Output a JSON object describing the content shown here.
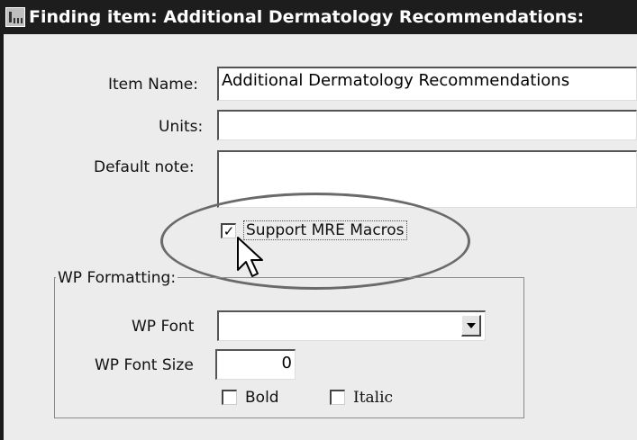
{
  "window": {
    "title": "Finding item: Additional Dermatology Recommendations:"
  },
  "form": {
    "item_name_label": "Item Name:",
    "item_name_value": "Additional Dermatology Recommendations",
    "units_label": "Units:",
    "units_value": "",
    "default_note_label": "Default note:",
    "default_note_value": "",
    "support_mre_label": "Support MRE Macros",
    "support_mre_checked": true
  },
  "wp_formatting": {
    "legend": "WP Formatting:",
    "font_label": "WP Font",
    "font_value": "",
    "font_size_label": "WP Font Size",
    "font_size_value": "0",
    "bold_label": "Bold",
    "bold_checked": false,
    "italic_label": "Italic",
    "italic_checked": false
  },
  "icons": {
    "title": "form-icon",
    "combo": "dropdown-arrow-icon",
    "cursor": "mouse-pointer-icon",
    "highlight": "ellipse-highlight"
  }
}
